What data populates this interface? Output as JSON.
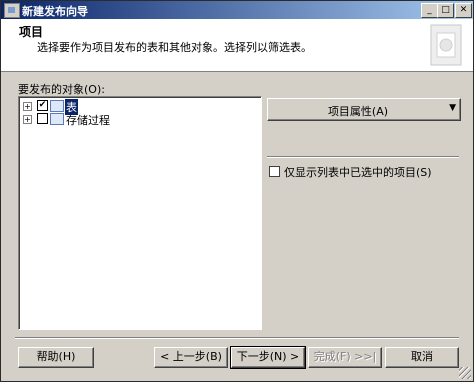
{
  "window": {
    "title": "新建发布向导",
    "controls": [
      "minimize",
      "maximize",
      "close"
    ]
  },
  "header": {
    "title": "项目",
    "description": "选择要作为项目发布的表和其他对象。选择列以筛选表。"
  },
  "objects": {
    "label": "要发布的对象(O):",
    "tree": [
      {
        "label": "表",
        "checked": true,
        "selected": true,
        "icon": "table-folder-icon"
      },
      {
        "label": "存储过程",
        "checked": false,
        "selected": false,
        "icon": "stored-procedure-folder-icon"
      }
    ]
  },
  "side": {
    "properties_button": "项目属性(A)",
    "show_only_checked_label": "仅显示列表中已选中的项目(S)",
    "show_only_checked": false
  },
  "footer": {
    "help": "帮助(H)",
    "back": "< 上一步(B)",
    "next": "下一步(N) >",
    "finish": "完成(F) >>|",
    "cancel": "取消"
  }
}
